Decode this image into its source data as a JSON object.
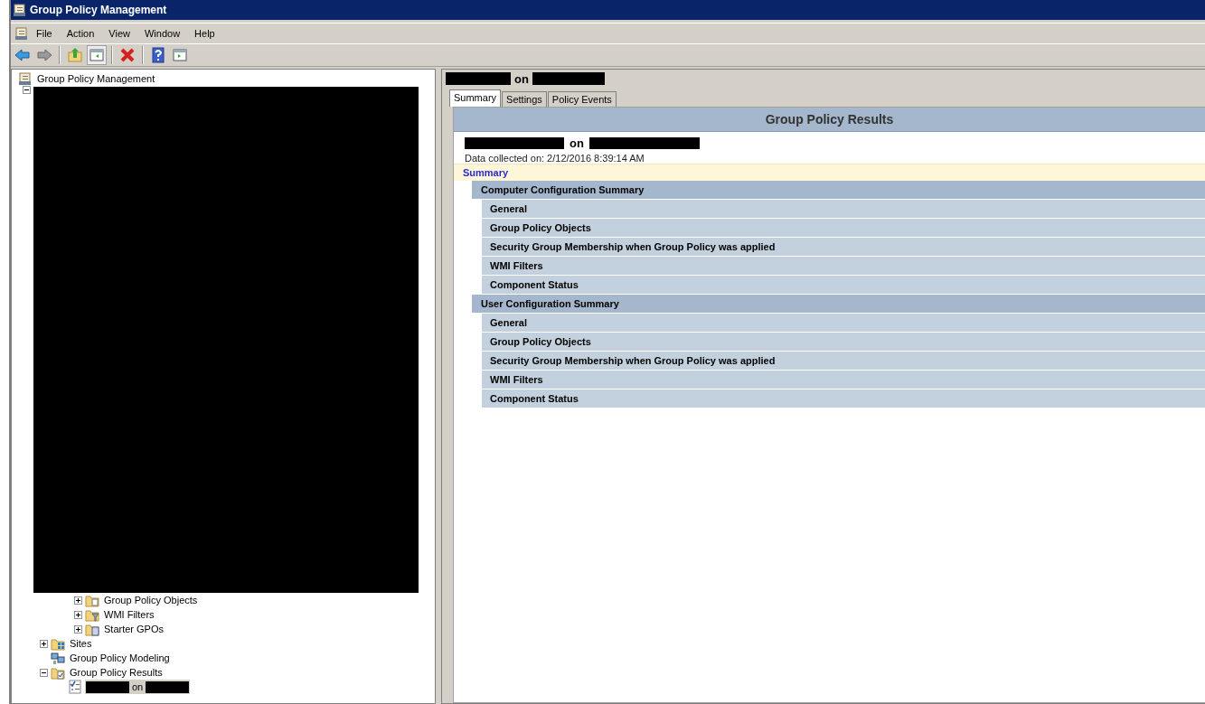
{
  "window": {
    "title": "Group Policy Management"
  },
  "menu": [
    "File",
    "Action",
    "View",
    "Window",
    "Help"
  ],
  "toolbar": [
    {
      "kind": "back",
      "pressed": false
    },
    {
      "kind": "forward",
      "pressed": false
    },
    {
      "kind": "sep"
    },
    {
      "kind": "up",
      "pressed": false
    },
    {
      "kind": "pane",
      "pressed": true
    },
    {
      "kind": "sep"
    },
    {
      "kind": "delete",
      "pressed": false
    },
    {
      "kind": "sep"
    },
    {
      "kind": "help",
      "pressed": false
    },
    {
      "kind": "action-pane",
      "pressed": false
    }
  ],
  "tree": [
    {
      "kind": "root",
      "label": "Group Policy Management",
      "selected": false,
      "children": [
        {
          "kind": "redacted",
          "expanded": true,
          "children": [
            {
              "kind": "hidden",
              "children": [
                {
                  "kind": "hidden",
                  "children": [
                    {
                      "kind": "gpo",
                      "label": "Group Policy Objects",
                      "expanded": false,
                      "selected": false
                    },
                    {
                      "kind": "wmi",
                      "label": "WMI Filters",
                      "expanded": false,
                      "selected": false
                    },
                    {
                      "kind": "starter",
                      "label": "Starter GPOs",
                      "expanded": false,
                      "selected": false
                    }
                  ]
                }
              ]
            },
            {
              "kind": "sites",
              "label": "Sites",
              "expanded": false,
              "selected": false
            },
            {
              "kind": "modeling",
              "label": "Group Policy Modeling",
              "selected": false
            },
            {
              "kind": "results",
              "label": "Group Policy Results",
              "expanded": true,
              "selected": false,
              "children": [
                {
                  "kind": "report",
                  "label": "on",
                  "selected": true
                }
              ]
            }
          ]
        }
      ]
    }
  ],
  "details": {
    "heading": "on",
    "tabs": [
      {
        "label": "Summary",
        "selected": true
      },
      {
        "label": "Settings",
        "selected": false
      },
      {
        "label": "Policy Events",
        "selected": false
      }
    ],
    "report": {
      "title": "Group Policy Results",
      "subject": "on",
      "collected": "Data collected on: 2/12/2016 8:39:14 AM",
      "summary_link": "Summary",
      "sections": [
        {
          "title": "Computer Configuration Summary",
          "items": [
            "General",
            "Group Policy Objects",
            "Security Group Membership when Group Policy was applied",
            "WMI Filters",
            "Component Status"
          ]
        },
        {
          "title": "User Configuration Summary",
          "items": [
            "General",
            "Group Policy Objects",
            "Security Group Membership when Group Policy was applied",
            "WMI Filters",
            "Component Status"
          ]
        }
      ]
    }
  }
}
